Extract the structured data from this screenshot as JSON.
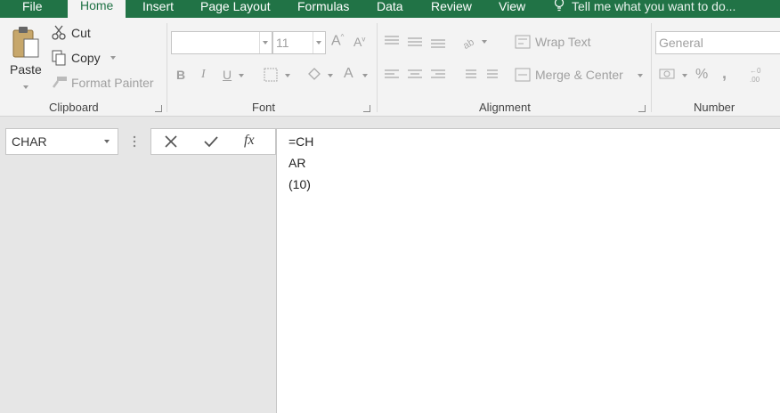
{
  "tabs": {
    "file": "File",
    "home": "Home",
    "insert": "Insert",
    "page_layout": "Page Layout",
    "formulas": "Formulas",
    "data": "Data",
    "review": "Review",
    "view": "View",
    "tell_me": "Tell me what you want to do..."
  },
  "clipboard": {
    "paste": "Paste",
    "cut": "Cut",
    "copy": "Copy",
    "format_painter": "Format Painter",
    "group_label": "Clipboard"
  },
  "font": {
    "font_name": "",
    "font_size": "11",
    "group_label": "Font",
    "bold": "B",
    "italic": "I",
    "underline": "U"
  },
  "alignment": {
    "wrap_text": "Wrap Text",
    "merge_center": "Merge & Center",
    "group_label": "Alignment"
  },
  "number": {
    "format": "General",
    "percent": "%",
    "comma": ",",
    "group_label": "Number"
  },
  "formula_bar": {
    "name_box": "CHAR",
    "fx": "fx",
    "content_lines": [
      "=CH",
      "AR",
      "(10)"
    ]
  },
  "colors": {
    "brand_green": "#217346",
    "ribbon_bg": "#f3f3f3"
  },
  "icons": [
    "clipboard-paste-icon",
    "scissors-icon",
    "copy-icon",
    "paintbrush-icon",
    "lightbulb-icon",
    "cancel-x-icon",
    "check-icon"
  ]
}
